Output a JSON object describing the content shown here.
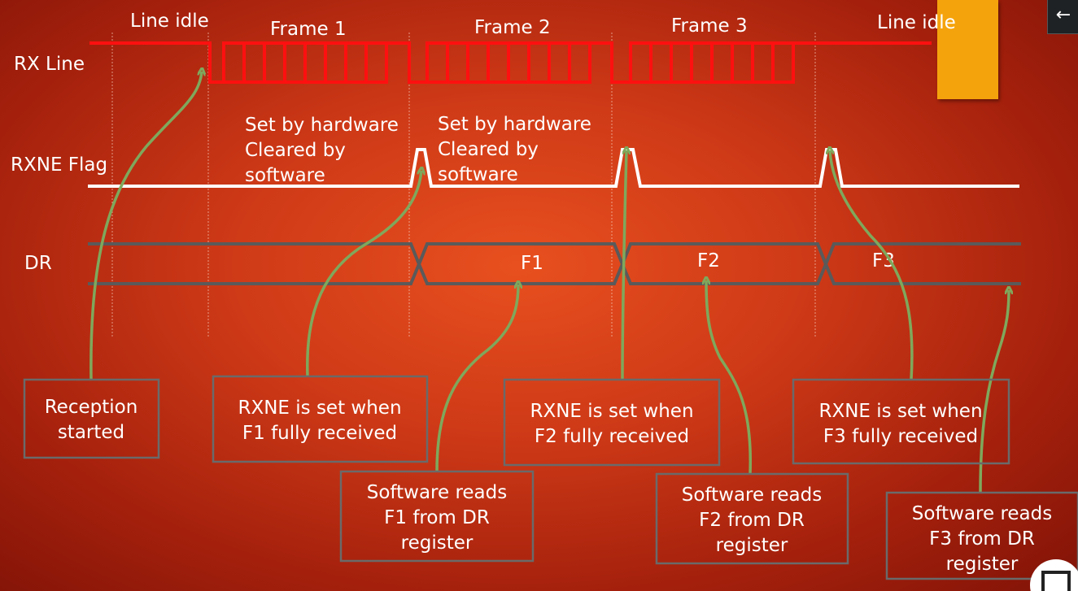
{
  "signals": {
    "rx_line": "RX Line",
    "rxne_flag": "RXNE Flag",
    "dr": "DR"
  },
  "rx_labels": {
    "idle_start": "Line idle",
    "frame1": "Frame 1",
    "frame2": "Frame 2",
    "frame3": "Frame 3",
    "idle_end": "Line idle"
  },
  "flag_notes": [
    {
      "line1": "Set by hardware",
      "line2": "Cleared by",
      "line3": "software"
    },
    {
      "line1": "Set by hardware",
      "line2": "Cleared by",
      "line3": "software"
    }
  ],
  "dr_values": [
    "F1",
    "F2",
    "F3"
  ],
  "callouts": [
    {
      "line1": "Reception",
      "line2": "started"
    },
    {
      "line1": "RXNE is set when",
      "line2": "F1 fully received"
    },
    {
      "line1": "Software reads",
      "line2": "F1 from DR",
      "line3": "register"
    },
    {
      "line1": "RXNE is set when",
      "line2": "F2 fully received"
    },
    {
      "line1": "Software reads",
      "line2": "F2 from DR",
      "line3": "register"
    },
    {
      "line1": "RXNE is set when",
      "line2": "F3 fully received"
    },
    {
      "line1": "Software reads",
      "line2": "F3 from DR",
      "line3": "register"
    }
  ],
  "colors": {
    "rx_line": "#ff1010",
    "flag": "#ffffff",
    "dr_bus": "#5a5a5a",
    "arrows": "#7fa85c",
    "accent_block": "#f5a30c"
  },
  "icons": {
    "back": "arrow-left-icon"
  }
}
